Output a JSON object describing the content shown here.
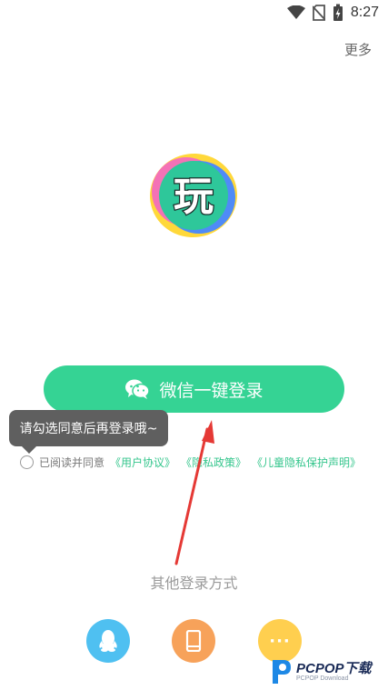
{
  "status_bar": {
    "time": "8:27"
  },
  "header": {
    "more_label": "更多"
  },
  "logo": {
    "glyph": "玩"
  },
  "wechat_login": {
    "label": "微信一键登录"
  },
  "tooltip": {
    "text": "请勾选同意后再登录哦~"
  },
  "agreement": {
    "prefix": "已阅读并同意",
    "links": [
      "《用户协议》",
      "《隐私政策》",
      "《儿童隐私保护声明》"
    ]
  },
  "other_login": {
    "title": "其他登录方式",
    "buttons": [
      {
        "name": "qq-icon"
      },
      {
        "name": "phone-icon"
      },
      {
        "name": "more-icon",
        "label": "···"
      }
    ]
  },
  "watermark": {
    "text": "PCPOP下载",
    "subtext": "PCPOP Download"
  },
  "colors": {
    "accent": "#35d394",
    "qq": "#4fc0f1",
    "phone": "#f7a25a",
    "more": "#ffcf4f",
    "link": "#35c68d",
    "arrow": "#e53935"
  }
}
